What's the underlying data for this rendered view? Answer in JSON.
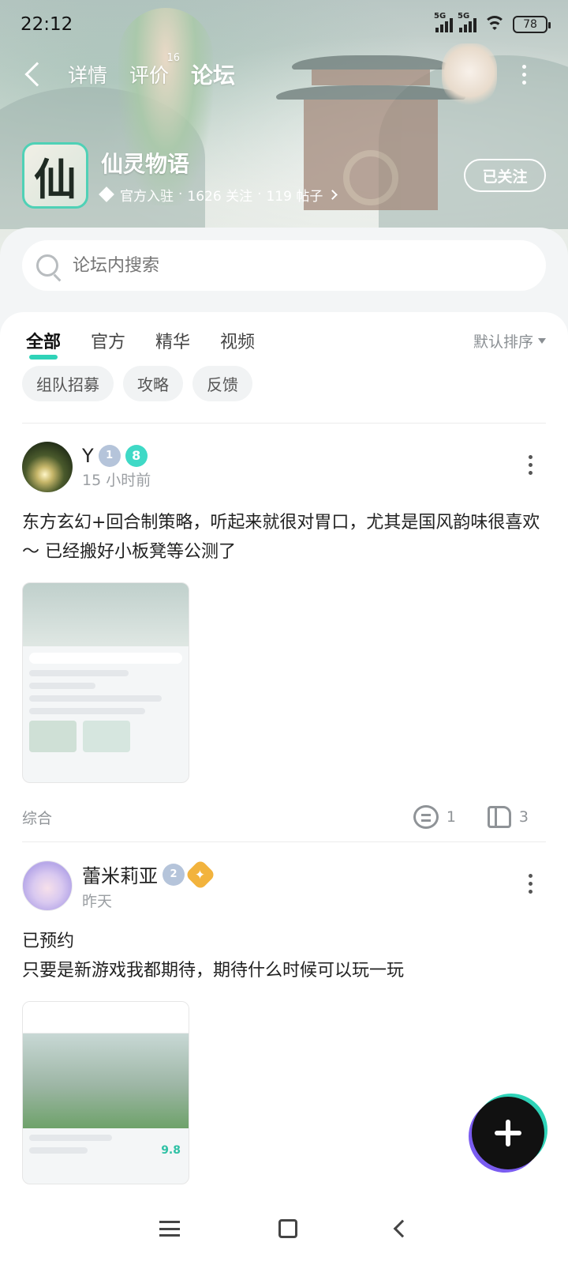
{
  "status_bar": {
    "time": "22:12",
    "signal1": "5G",
    "signal2": "5G",
    "battery": "78"
  },
  "top_nav": {
    "tabs": [
      {
        "label": "详情"
      },
      {
        "label": "评价",
        "badge": "16"
      },
      {
        "label": "论坛"
      }
    ]
  },
  "game": {
    "icon_char": "仙",
    "name": "仙灵物语",
    "verified": "官方入驻",
    "followers": "1626 关注",
    "posts": "119 帖子",
    "sep": "·",
    "follow_label": "已关注"
  },
  "search": {
    "placeholder": "论坛内搜索"
  },
  "filter_tabs": [
    "全部",
    "官方",
    "精华",
    "视频"
  ],
  "sort_label": "默认排序",
  "chips": [
    "组队招募",
    "攻略",
    "反馈"
  ],
  "posts": [
    {
      "username": "Y",
      "level": "1",
      "medal": "8",
      "time": "15 小时前",
      "text": "东方玄幻+回合制策略，听起来就很对胃口，尤其是国风韵味很喜欢～ 已经搬好小板凳等公测了",
      "category": "综合",
      "comments": "1",
      "likes": "3"
    },
    {
      "username": "蕾米莉亚",
      "level": "2",
      "time": "昨天",
      "text_line1": "已预约",
      "text_line2": "只要是新游戏我都期待，期待什么时候可以玩一玩"
    }
  ],
  "colors": {
    "accent": "#2fd3b8",
    "text": "#222222",
    "muted": "#8f9397"
  }
}
